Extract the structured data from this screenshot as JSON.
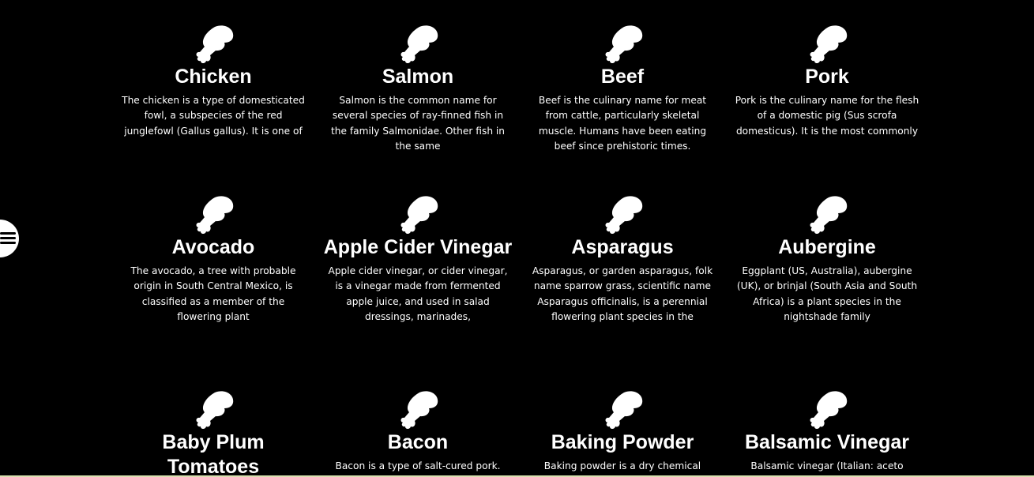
{
  "colors": {
    "background": "#000000",
    "text": "#ffffff",
    "icon": "#ffffff"
  },
  "menu": {
    "icon": "hamburger-icon"
  },
  "cards": [
    {
      "icon": "drumstick-icon",
      "title": "Chicken",
      "description": "The chicken is a type of domesticated fowl, a subspecies of the red junglefowl (Gallus gallus). It is one of"
    },
    {
      "icon": "drumstick-icon",
      "title": "Salmon",
      "description": "Salmon is the common name for several species of ray-finned fish in the family Salmonidae. Other fish in the same"
    },
    {
      "icon": "drumstick-icon",
      "title": "Beef",
      "description": "Beef is the culinary name for meat from cattle, particularly skeletal muscle. Humans have been eating beef since prehistoric times."
    },
    {
      "icon": "drumstick-icon",
      "title": "Pork",
      "description": "Pork is the culinary name for the flesh of a domestic pig (Sus scrofa domesticus). It is the most commonly"
    },
    {
      "icon": "drumstick-icon",
      "title": "Avocado",
      "description": "The avocado, a tree with probable origin in South Central Mexico, is classified as a member of the flowering plant"
    },
    {
      "icon": "drumstick-icon",
      "title": "Apple Cider Vinegar",
      "description": "Apple cider vinegar, or cider vinegar, is a vinegar made from fermented apple juice, and used in salad dressings, marinades,"
    },
    {
      "icon": "drumstick-icon",
      "title": "Asparagus",
      "description": "Asparagus, or garden asparagus, folk name sparrow grass, scientific name Asparagus officinalis, is a perennial flowering plant species in the"
    },
    {
      "icon": "drumstick-icon",
      "title": "Aubergine",
      "description": "Eggplant (US, Australia), aubergine (UK), or brinjal (South Asia and South Africa) is a plant species in the nightshade family"
    },
    {
      "icon": "drumstick-icon",
      "title": "Baby Plum Tomatoes",
      "description": ""
    },
    {
      "icon": "drumstick-icon",
      "title": "Bacon",
      "description": "Bacon is a type of salt-cured pork. Bacon"
    },
    {
      "icon": "drumstick-icon",
      "title": "Baking Powder",
      "description": "Baking powder is a dry chemical"
    },
    {
      "icon": "drumstick-icon",
      "title": "Balsamic Vinegar",
      "description": "Balsamic vinegar (Italian: aceto"
    }
  ]
}
